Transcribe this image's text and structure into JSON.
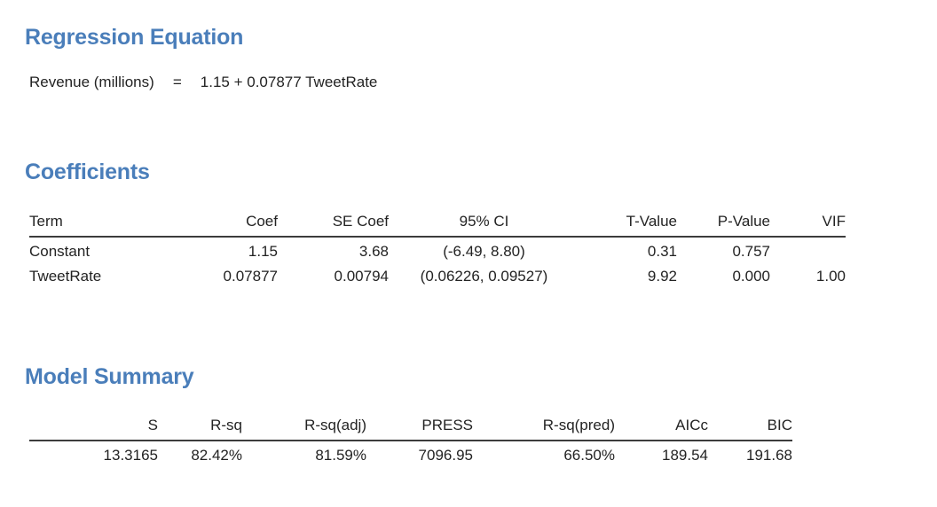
{
  "colors": {
    "heading": "#4a7eba",
    "body_text": "#232323",
    "rule": "#3c3c3c",
    "background": "#ffffff"
  },
  "regression_equation": {
    "heading": "Regression Equation",
    "response": "Revenue (millions)",
    "equals": "=",
    "expression": "1.15 + 0.07877 TweetRate"
  },
  "coefficients": {
    "heading": "Coefficients",
    "columns": [
      "Term",
      "Coef",
      "SE Coef",
      "95% CI",
      "T-Value",
      "P-Value",
      "VIF"
    ],
    "rows": [
      {
        "term": "Constant",
        "coef": "1.15",
        "se_coef": "3.68",
        "ci": "(-6.49, 8.80)",
        "t_value": "0.31",
        "p_value": "0.757",
        "vif": ""
      },
      {
        "term": "TweetRate",
        "coef": "0.07877",
        "se_coef": "0.00794",
        "ci": "(0.06226, 0.09527)",
        "t_value": "9.92",
        "p_value": "0.000",
        "vif": "1.00"
      }
    ]
  },
  "model_summary": {
    "heading": "Model Summary",
    "columns": [
      "S",
      "R-sq",
      "R-sq(adj)",
      "PRESS",
      "R-sq(pred)",
      "AICc",
      "BIC"
    ],
    "rows": [
      {
        "s": "13.3165",
        "r_sq": "82.42%",
        "r_sq_adj": "81.59%",
        "press": "7096.95",
        "r_sq_pred": "66.50%",
        "aicc": "189.54",
        "bic": "191.68"
      }
    ]
  }
}
